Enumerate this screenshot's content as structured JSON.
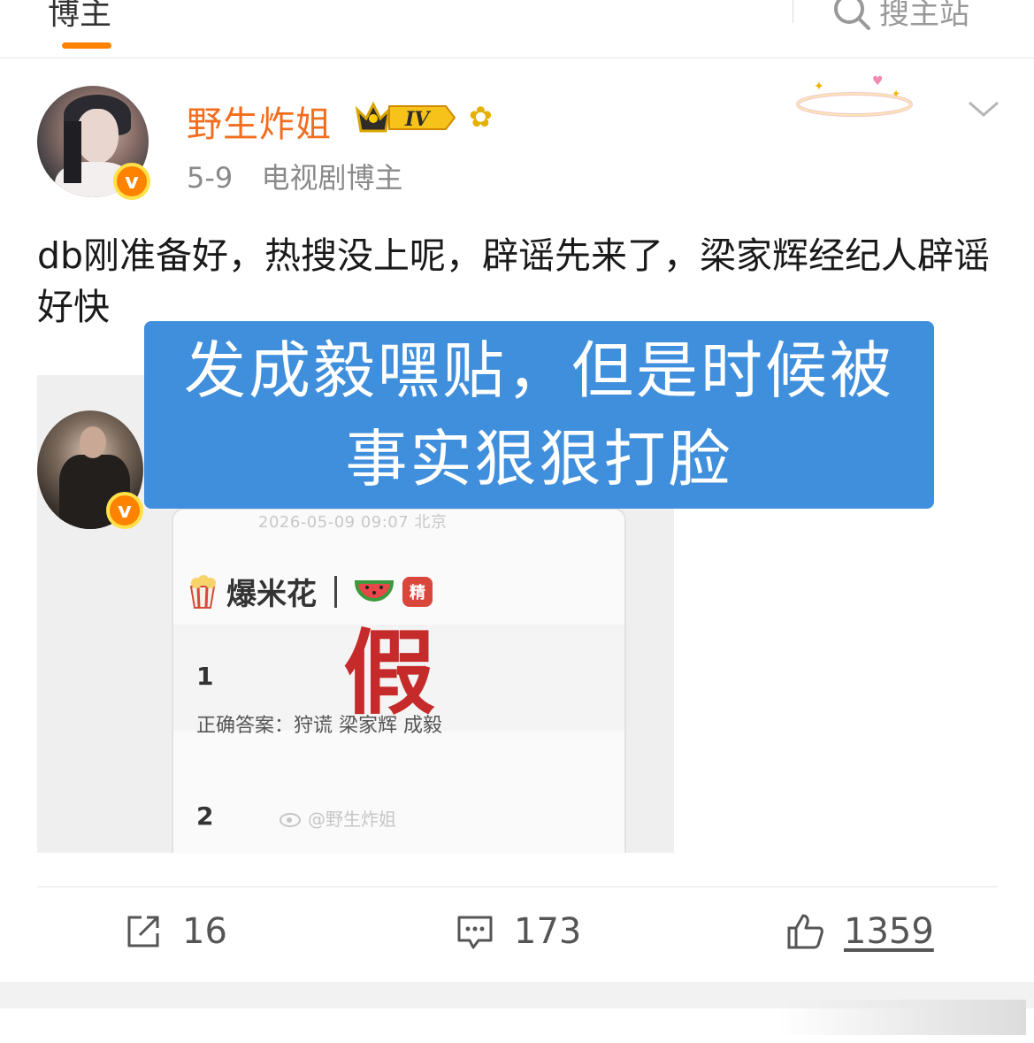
{
  "topbar": {
    "active_tab": "博主",
    "search_placeholder": "搜主站"
  },
  "post": {
    "author": "野生炸姐",
    "level_badge": "IV",
    "date": "5-9",
    "source": "电视剧博主",
    "text": "db刚准备好，热搜没上呢，辟谣先来了，梁家辉经纪人辟谣好快",
    "media": {
      "inner_time": "2026-05-09 09:07  北京",
      "popcorn_title": "爆米花",
      "jing_badge": "精",
      "jia_text": "假",
      "item1_number": "1",
      "item1_answer": "正确答案：狩谎 梁家辉 成毅",
      "item2_number": "2",
      "watermark": "@野生炸姐"
    },
    "caption_line1": "发成毅嘿贴，但是时候被",
    "caption_line2": "事实狠狠打脸"
  },
  "actions": {
    "repost_count": "16",
    "comment_count": "173",
    "like_count": "1359"
  },
  "colors": {
    "accent": "#ff8200",
    "username": "#f26d1d",
    "caption_bg": "#3f8fdc"
  }
}
